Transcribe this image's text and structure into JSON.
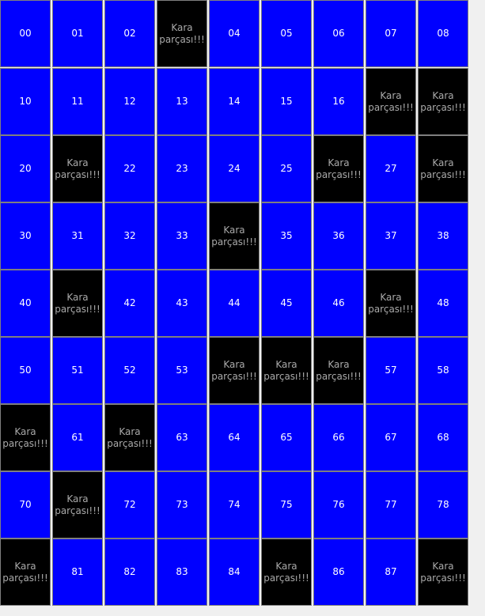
{
  "colors": {
    "active": "#0000ff",
    "black": "#000000",
    "black_text": "#a9a9a9",
    "window_bg": "#f0f0f0"
  },
  "grid": {
    "rows": [
      [
        {
          "text": "00",
          "state": "blue"
        },
        {
          "text": "01",
          "state": "blue"
        },
        {
          "text": "02",
          "state": "blue"
        },
        {
          "text": "Kara\nparçası!!!",
          "state": "black"
        },
        {
          "text": "04",
          "state": "blue"
        },
        {
          "text": "05",
          "state": "blue"
        },
        {
          "text": "06",
          "state": "blue"
        },
        {
          "text": "07",
          "state": "blue"
        },
        {
          "text": "08",
          "state": "blue"
        }
      ],
      [
        {
          "text": "10",
          "state": "blue"
        },
        {
          "text": "11",
          "state": "blue"
        },
        {
          "text": "12",
          "state": "blue"
        },
        {
          "text": "13",
          "state": "blue"
        },
        {
          "text": "14",
          "state": "blue"
        },
        {
          "text": "15",
          "state": "blue"
        },
        {
          "text": "16",
          "state": "blue"
        },
        {
          "text": "Kara\nparçası!!!",
          "state": "black"
        },
        {
          "text": "Kara\nparçası!!!",
          "state": "black"
        }
      ],
      [
        {
          "text": "20",
          "state": "blue"
        },
        {
          "text": "Kara\nparçası!!!",
          "state": "black"
        },
        {
          "text": "22",
          "state": "blue"
        },
        {
          "text": "23",
          "state": "blue"
        },
        {
          "text": "24",
          "state": "blue"
        },
        {
          "text": "25",
          "state": "blue"
        },
        {
          "text": "Kara\nparçası!!!",
          "state": "black"
        },
        {
          "text": "27",
          "state": "blue"
        },
        {
          "text": "Kara\nparçası!!!",
          "state": "black"
        }
      ],
      [
        {
          "text": "30",
          "state": "blue"
        },
        {
          "text": "31",
          "state": "blue"
        },
        {
          "text": "32",
          "state": "blue"
        },
        {
          "text": "33",
          "state": "blue"
        },
        {
          "text": "Kara\nparçası!!!",
          "state": "black"
        },
        {
          "text": "35",
          "state": "blue"
        },
        {
          "text": "36",
          "state": "blue"
        },
        {
          "text": "37",
          "state": "blue"
        },
        {
          "text": "38",
          "state": "blue"
        }
      ],
      [
        {
          "text": "40",
          "state": "blue"
        },
        {
          "text": "Kara\nparçası!!!",
          "state": "black"
        },
        {
          "text": "42",
          "state": "blue"
        },
        {
          "text": "43",
          "state": "blue"
        },
        {
          "text": "44",
          "state": "blue"
        },
        {
          "text": "45",
          "state": "blue"
        },
        {
          "text": "46",
          "state": "blue"
        },
        {
          "text": "Kara\nparçası!!!",
          "state": "black"
        },
        {
          "text": "48",
          "state": "blue"
        }
      ],
      [
        {
          "text": "50",
          "state": "blue"
        },
        {
          "text": "51",
          "state": "blue"
        },
        {
          "text": "52",
          "state": "blue"
        },
        {
          "text": "53",
          "state": "blue"
        },
        {
          "text": "Kara\nparçası!!!",
          "state": "black"
        },
        {
          "text": "Kara\nparçası!!!",
          "state": "black"
        },
        {
          "text": "Kara\nparçası!!!",
          "state": "black"
        },
        {
          "text": "57",
          "state": "blue"
        },
        {
          "text": "58",
          "state": "blue"
        }
      ],
      [
        {
          "text": "Kara\nparçası!!!",
          "state": "black"
        },
        {
          "text": "61",
          "state": "blue"
        },
        {
          "text": "Kara\nparçası!!!",
          "state": "black"
        },
        {
          "text": "63",
          "state": "blue"
        },
        {
          "text": "64",
          "state": "blue"
        },
        {
          "text": "65",
          "state": "blue"
        },
        {
          "text": "66",
          "state": "blue"
        },
        {
          "text": "67",
          "state": "blue"
        },
        {
          "text": "68",
          "state": "blue"
        }
      ],
      [
        {
          "text": "70",
          "state": "blue"
        },
        {
          "text": "Kara\nparçası!!!",
          "state": "black"
        },
        {
          "text": "72",
          "state": "blue"
        },
        {
          "text": "73",
          "state": "blue"
        },
        {
          "text": "74",
          "state": "blue"
        },
        {
          "text": "75",
          "state": "blue"
        },
        {
          "text": "76",
          "state": "blue"
        },
        {
          "text": "77",
          "state": "blue"
        },
        {
          "text": "78",
          "state": "blue"
        }
      ],
      [
        {
          "text": "Kara\nparçası!!!",
          "state": "black"
        },
        {
          "text": "81",
          "state": "blue"
        },
        {
          "text": "82",
          "state": "blue"
        },
        {
          "text": "83",
          "state": "blue"
        },
        {
          "text": "84",
          "state": "blue"
        },
        {
          "text": "Kara\nparçası!!!",
          "state": "black"
        },
        {
          "text": "86",
          "state": "blue"
        },
        {
          "text": "87",
          "state": "blue"
        },
        {
          "text": "Kara\nparçası!!!",
          "state": "black"
        }
      ]
    ]
  }
}
